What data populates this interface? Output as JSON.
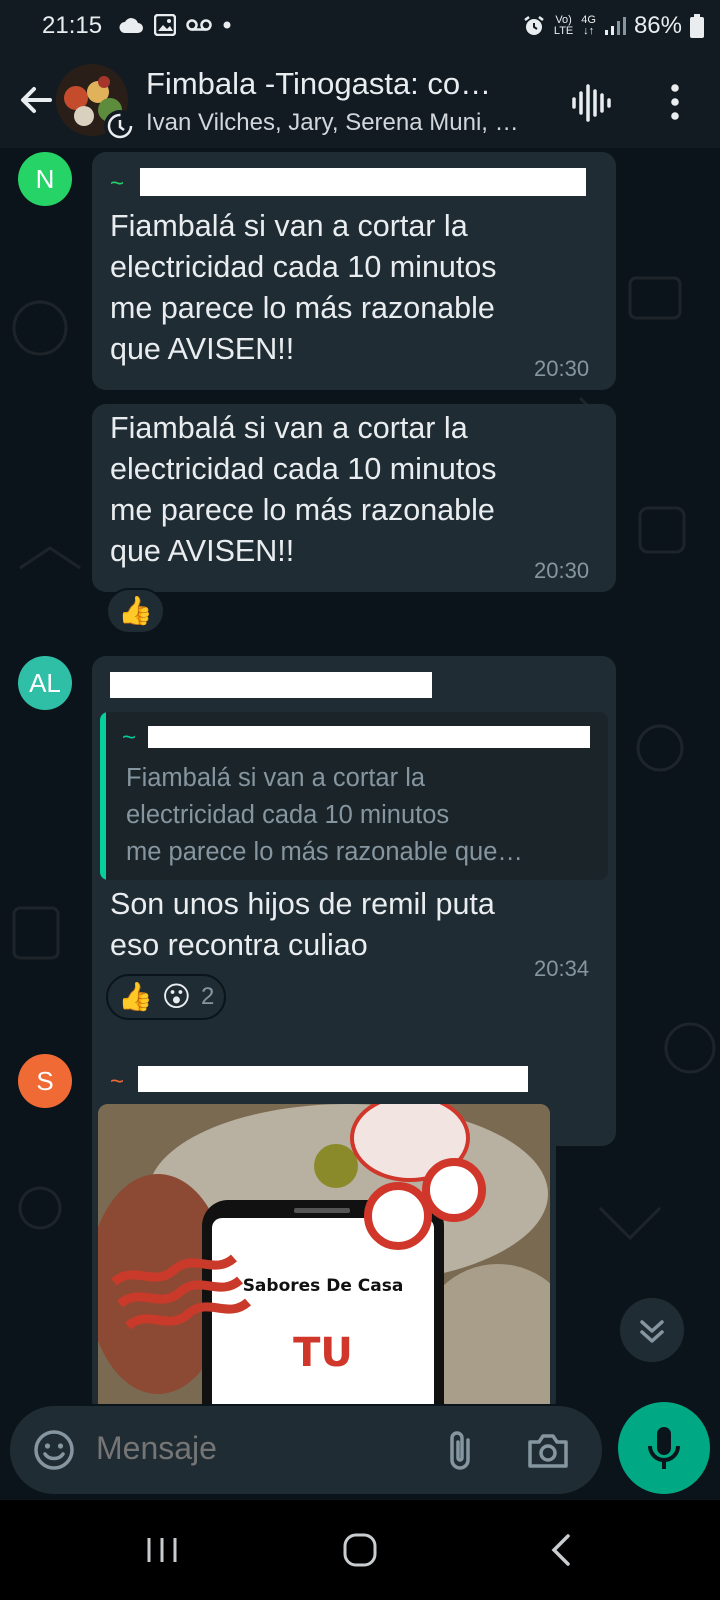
{
  "status_bar": {
    "time": "21:15",
    "network_top": "Vo)",
    "network_bottom": "LTE",
    "gen_top": "4G",
    "battery": "86%",
    "icons": [
      "cloud-icon",
      "gallery-icon",
      "voicemail-icon",
      "dot-icon",
      "alarm-icon",
      "signal-icon",
      "battery-icon"
    ]
  },
  "header": {
    "title": "Fimbala -Tinogasta: co…",
    "subtitle": "Ivan Vilches, Jary, Serena Muni, …"
  },
  "messages": [
    {
      "avatar_initials": "N",
      "avatar_color": "#25d366",
      "sender_prefix": "~",
      "text_lines": [
        "Fiambalá si van a cortar la",
        "electricidad cada 10 minutos",
        "me parece lo más razonable",
        "que AVISEN!!"
      ],
      "time": "20:30"
    },
    {
      "text_lines": [
        "Fiambalá si van a cortar la",
        "electricidad cada 10 minutos",
        "me parece lo más razonable",
        "que AVISEN!!"
      ],
      "time": "20:30",
      "reaction": "👍"
    },
    {
      "avatar_initials": "AL",
      "avatar_color": "#2fbfa6",
      "quote_prefix": "~",
      "quote_lines": [
        "Fiambalá si van a cortar la",
        "electricidad cada 10 minutos",
        "me parece lo más razonable que…"
      ],
      "text_lines": [
        "Son unos hijos de remil puta",
        "eso recontra culiao"
      ],
      "time": "20:34",
      "reaction": "👍 😮",
      "reaction_count": "2"
    },
    {
      "avatar_initials": "S",
      "avatar_color": "#f06a35",
      "sender_prefix": "~",
      "image_title": "Sabores De Casa",
      "image_big_text": "TU"
    }
  ],
  "composer": {
    "placeholder": "Mensaje"
  },
  "colors": {
    "background": "#0b141a",
    "bubble": "#202c33",
    "accent": "#00a884",
    "time_text": "#8696a0"
  }
}
